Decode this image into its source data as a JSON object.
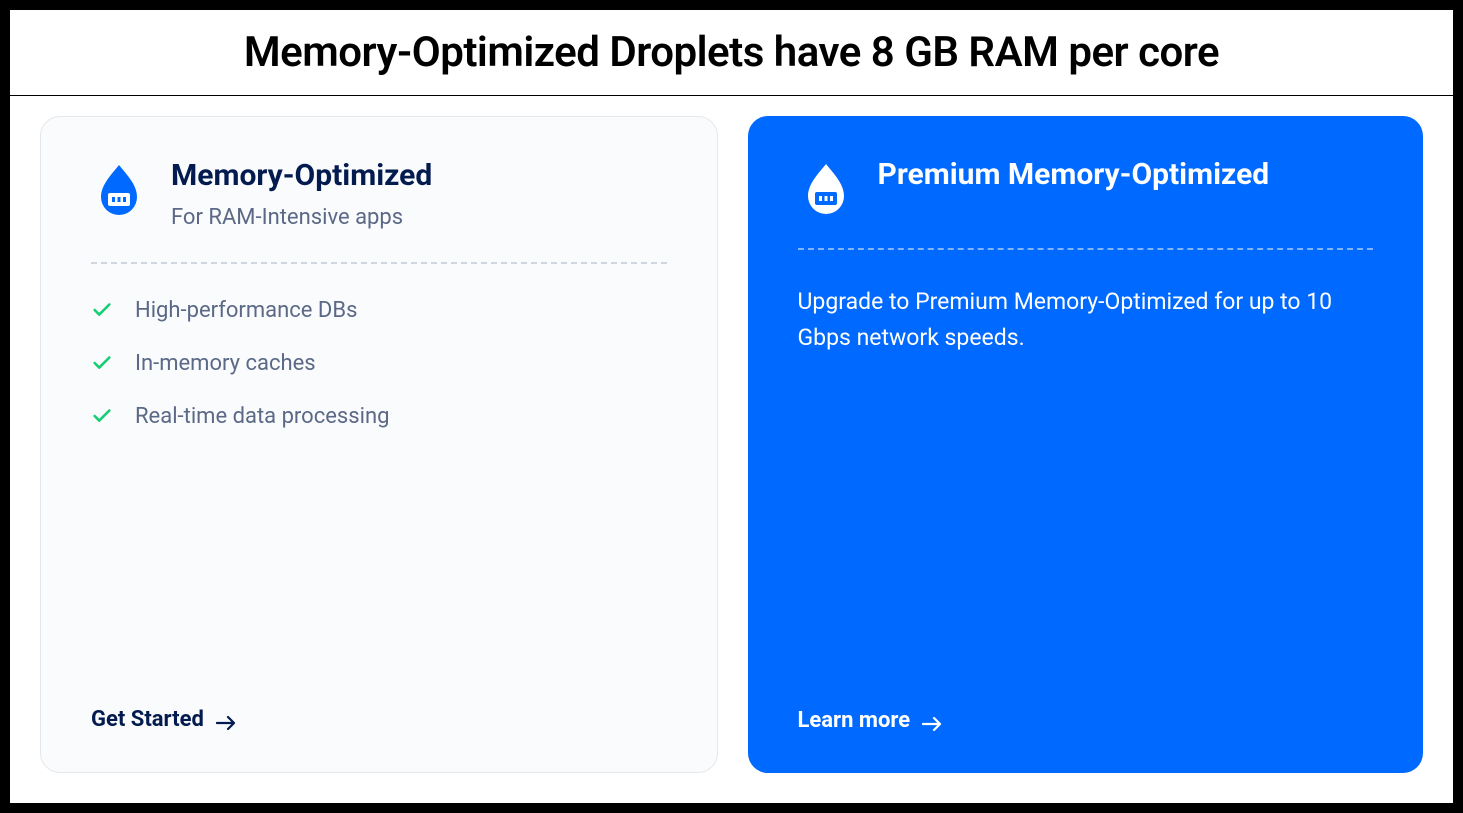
{
  "banner": {
    "text": "Memory-Optimized Droplets have 8 GB RAM per core"
  },
  "cards": {
    "memory_optimized": {
      "title": "Memory-Optimized",
      "subtitle": "For RAM-Intensive apps",
      "features": [
        "High-performance DBs",
        "In-memory caches",
        "Real-time data processing"
      ],
      "cta_label": "Get Started"
    },
    "premium": {
      "title": "Premium Memory-Optimized",
      "description": "Upgrade to Premium Memory-Optimized for up to 10 Gbps network speeds.",
      "cta_label": "Learn more"
    }
  },
  "colors": {
    "blue": "#0069ff",
    "green": "#15cd72",
    "text_dark": "#031b4e",
    "text_muted": "#5b6987"
  }
}
